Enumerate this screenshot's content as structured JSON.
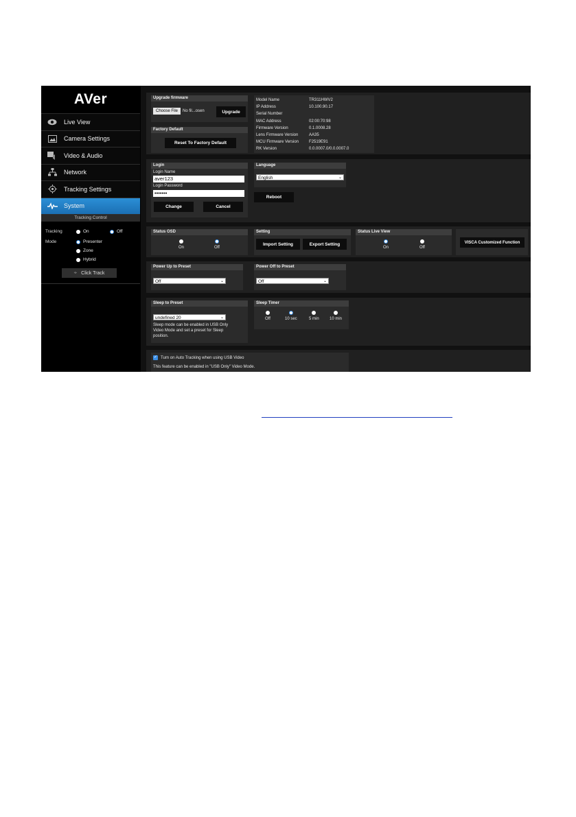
{
  "brand": {
    "logo": "AVer"
  },
  "nav": {
    "items": [
      {
        "label": "Live View",
        "icon": "eye-icon"
      },
      {
        "label": "Camera Settings",
        "icon": "image-icon"
      },
      {
        "label": "Video & Audio",
        "icon": "speaker-icon"
      },
      {
        "label": "Network",
        "icon": "network-icon"
      },
      {
        "label": "Tracking Settings",
        "icon": "crosshair-icon"
      },
      {
        "label": "System",
        "icon": "pulse-icon",
        "active": true
      }
    ]
  },
  "tracking_control": {
    "title": "Tracking Control",
    "tracking_label": "Tracking",
    "on": "On",
    "off": "Off",
    "tracking_value": "Off",
    "mode_label": "Mode",
    "modes": [
      "Presenter",
      "Zone",
      "Hybrid"
    ],
    "mode_value": "Presenter",
    "click_track": "Click Track"
  },
  "upgrade": {
    "title": "Upgrade firmware",
    "choose_file": "Choose File",
    "file_name": "No fil...osen",
    "upgrade_button": "Upgrade"
  },
  "factory": {
    "title": "Factory Default",
    "reset_button": "Reset To Factory Default"
  },
  "info": {
    "rows": [
      {
        "label": "Model Name",
        "value": "TR311HWV2"
      },
      {
        "label": "IP Address",
        "value": "10.100.90.17"
      },
      {
        "label": "Serial Number",
        "value": ""
      },
      {
        "label": "MAC Address",
        "value": "02:00:70:98"
      },
      {
        "label": "Firmware Version",
        "value": "0.1.0008.28"
      },
      {
        "label": "Lens Firmware Version",
        "value": "AA35"
      },
      {
        "label": "MCU Firmware Version",
        "value": "F2519E91"
      },
      {
        "label": "RK Version",
        "value": "0.0.0007.0/0.0.0007.0"
      }
    ]
  },
  "login": {
    "title": "Login",
    "name_label": "Login Name",
    "name_value": "aver123",
    "password_label": "Login Password",
    "password_value": "•••••••",
    "change": "Change",
    "cancel": "Cancel"
  },
  "language": {
    "title": "Language",
    "value": "English",
    "reboot": "Reboot"
  },
  "status_osd": {
    "title": "Status OSD",
    "on": "On",
    "off": "Off",
    "value": "Off"
  },
  "setting": {
    "title": "Setting",
    "import": "Import Setting",
    "export": "Export Setting"
  },
  "status_live_view": {
    "title": "Status Live View",
    "on": "On",
    "off": "Off",
    "value": "On"
  },
  "visca": {
    "label": "VISCA Customized Function"
  },
  "power_up": {
    "title": "Power Up to Preset",
    "value": "Off"
  },
  "power_off": {
    "title": "Power Off to Preset",
    "value": "Off"
  },
  "sleep_preset": {
    "title": "Sleep to Preset",
    "value": "undefined 20",
    "note_lines": [
      "Sleep mode can be enabled in USB Only",
      "Video Mode and set a preset for Sleep",
      "position."
    ]
  },
  "sleep_timer": {
    "title": "Sleep Timer",
    "options": [
      "Off",
      "10 sec",
      "5 min",
      "10 min"
    ],
    "value": "10 sec"
  },
  "usb": {
    "checkbox_label": "Turn on Auto Tracking when using USB Video",
    "note": "This feature can be enabled in \"USB Only\" Video Mode."
  },
  "colors": {
    "accent": "#2b8fd6",
    "background": "#000000",
    "panel": "#2b2b2b"
  }
}
